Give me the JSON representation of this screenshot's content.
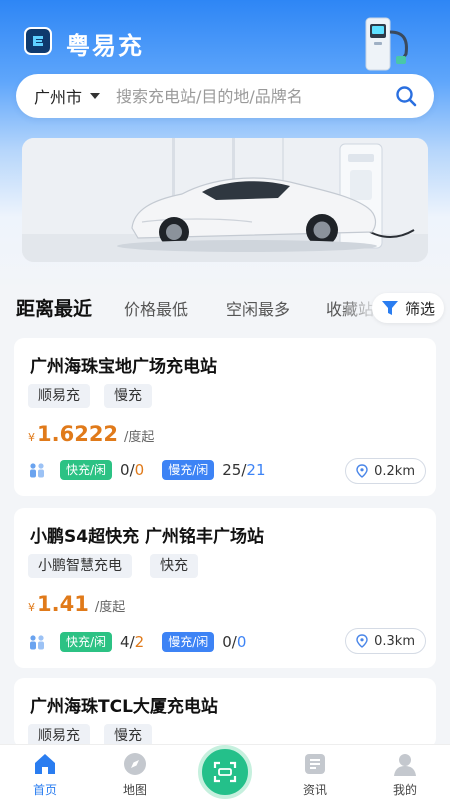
{
  "header": {
    "app_title": "粤易充"
  },
  "search": {
    "city": "广州市",
    "placeholder": "搜索充电站/目的地/品牌名"
  },
  "tabs": [
    {
      "label": "距离最近",
      "active": true
    },
    {
      "label": "价格最低",
      "active": false
    },
    {
      "label": "空闲最多",
      "active": false
    },
    {
      "label": "收藏站",
      "active": false
    }
  ],
  "filter_label": "筛选",
  "stations": [
    {
      "name": "广州海珠宝地广场充电站",
      "tags": [
        "顺易充",
        "慢充"
      ],
      "currency": "¥",
      "price": "1.6222",
      "unit": "/度起",
      "fast_label": "快充/闲",
      "fast_total": "0",
      "fast_free": "0",
      "slow_label": "慢充/闲",
      "slow_total": "25",
      "slow_free": "21",
      "distance": "0.2km"
    },
    {
      "name": "小鹏S4超快充 广州铭丰广场站",
      "tags": [
        "小鹏智慧充电",
        "快充"
      ],
      "currency": "¥",
      "price": "1.41",
      "unit": "/度起",
      "fast_label": "快充/闲",
      "fast_total": "4",
      "fast_free": "2",
      "slow_label": "慢充/闲",
      "slow_total": "0",
      "slow_free": "0",
      "distance": "0.3km"
    },
    {
      "name": "广州海珠TCL大厦充电站",
      "tags": [
        "顺易充",
        "慢充"
      ]
    }
  ],
  "nav": [
    {
      "label": "首页",
      "icon": "home-icon",
      "active": true
    },
    {
      "label": "地图",
      "icon": "compass-icon",
      "active": false
    },
    {
      "label": "资讯",
      "icon": "news-icon",
      "active": false
    },
    {
      "label": "我的",
      "icon": "profile-icon",
      "active": false
    }
  ],
  "colors": {
    "accent": "#2a7df0",
    "price": "#e07a1a",
    "fast_chip": "#2cc284",
    "slow_chip": "#3d83f5"
  }
}
